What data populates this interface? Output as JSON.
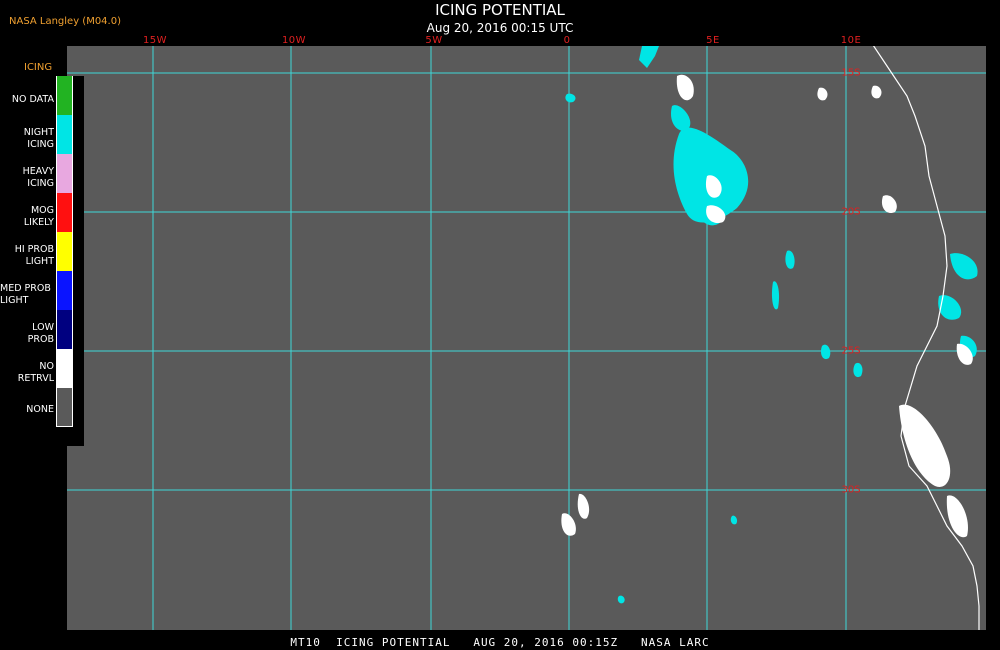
{
  "header": {
    "brand": "NASA Langley (M04.0)",
    "title": "ICING POTENTIAL",
    "subtitle": "Aug 20, 2016 00:15 UTC"
  },
  "map": {
    "background_color": "#5a5a5a",
    "grid_color": "#3fd8d8",
    "coast_color": "#ffffff",
    "lon_labels": [
      "15W",
      "10W",
      "5W",
      "0",
      "5E",
      "10E"
    ],
    "lat_labels": [
      "15S",
      "20S",
      "25S",
      "30S"
    ]
  },
  "legend": {
    "title": "ICING",
    "items": [
      {
        "label": "NO DATA",
        "color": "#22b322"
      },
      {
        "label": "NIGHT\nICING",
        "color": "#00e5e5"
      },
      {
        "label": "HEAVY\nICING",
        "color": "#e8a8e0"
      },
      {
        "label": "MOG\nLIKELY",
        "color": "#ff1010"
      },
      {
        "label": "HI PROB\nLIGHT",
        "color": "#ffff00"
      },
      {
        "label": "MED PROB\nLIGHT",
        "color": "#0a14ff"
      },
      {
        "label": "LOW\nPROB",
        "color": "#000080"
      },
      {
        "label": "NO\nRETRVL",
        "color": "#ffffff"
      },
      {
        "label": "NONE",
        "color": "#5a5a5a"
      }
    ]
  },
  "footer": {
    "text": "MT10  ICING POTENTIAL   AUG 20, 2016 00:15Z   NASA LARC"
  }
}
